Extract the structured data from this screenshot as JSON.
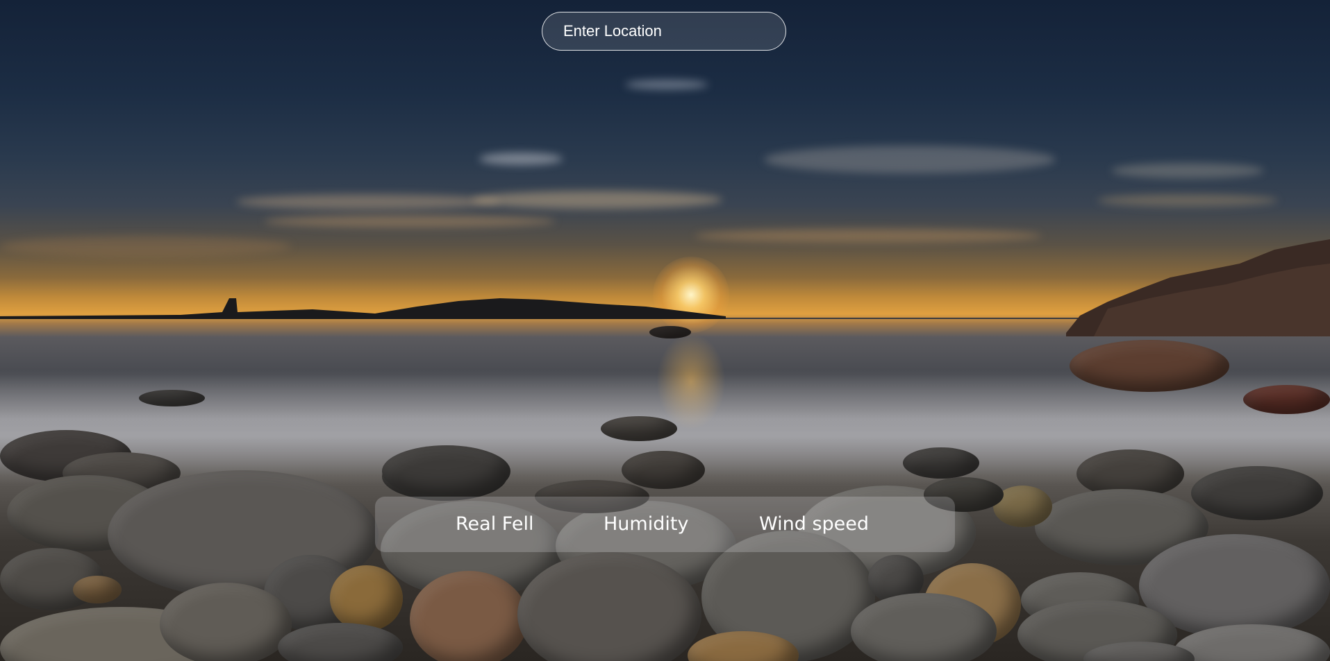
{
  "search": {
    "placeholder": "Enter Location"
  },
  "metrics": {
    "items": [
      {
        "label": "Real Fell"
      },
      {
        "label": "Humidity"
      },
      {
        "label": "Wind speed"
      }
    ]
  },
  "background": {
    "scene": "beach-sunset-pebbles",
    "colors": {
      "sky_top": "#142238",
      "horizon": "#e0a040",
      "sea": "#5b5a5e",
      "stones": "#3c3834"
    }
  }
}
